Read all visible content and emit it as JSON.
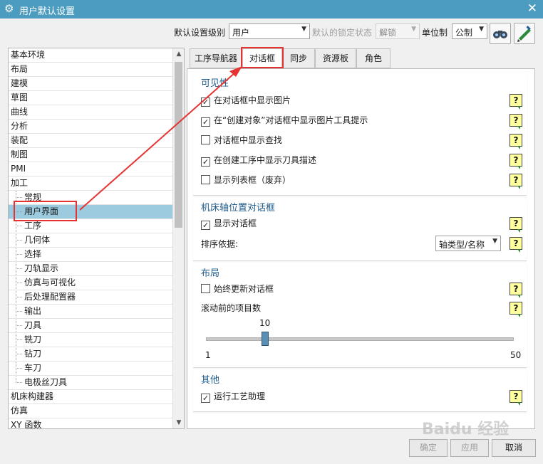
{
  "window": {
    "title": "用户默认设置",
    "close_label": "✕"
  },
  "toolbar": {
    "level_label": "默认设置级别",
    "level_value": "用户",
    "lock_label": "默认的锁定状态",
    "lock_value": "解锁",
    "unit_label": "单位制",
    "unit_value": "公制"
  },
  "tree": {
    "items": [
      "基本环境",
      "布局",
      "建模",
      "草图",
      "曲线",
      "分析",
      "装配",
      "制图",
      "PMI",
      "加工",
      "常规",
      "用户界面",
      "工序",
      "几何体",
      "选择",
      "刀轨显示",
      "仿真与可视化",
      "后处理配置器",
      "输出",
      "刀具",
      "铣刀",
      "钻刀",
      "车刀",
      "电极丝刀具",
      "机床构建器",
      "仿真",
      "XY 函数"
    ],
    "selected_index": 11
  },
  "tabs": [
    "工序导航器",
    "对话框",
    "同步",
    "资源板",
    "角色"
  ],
  "active_tab": 1,
  "sections": {
    "visibility": {
      "title": "可见性",
      "items": [
        {
          "label": "在对话框中显示图片",
          "checked": true
        },
        {
          "label": "在“创建对象”对话框中显示图片工具提示",
          "checked": true
        },
        {
          "label": "对话框中显示查找",
          "checked": false
        },
        {
          "label": "在创建工序中显示刀具描述",
          "checked": true
        },
        {
          "label": "显示列表框（废弃）",
          "checked": false
        }
      ]
    },
    "mcs": {
      "title": "机床轴位置对话框",
      "show_dialog": {
        "label": "显示对话框",
        "checked": true
      },
      "sort_label": "排序依据:",
      "sort_value": "轴类型/名称"
    },
    "layout": {
      "title": "布局",
      "always_update": {
        "label": "始终更新对话框",
        "checked": false
      },
      "scroll_label": "滚动前的项目数",
      "slider": {
        "value": "10",
        "min": "1",
        "max": "50"
      }
    },
    "other": {
      "title": "其他",
      "run_assistant": {
        "label": "运行工艺助理",
        "checked": true
      }
    }
  },
  "help_glyph": "?",
  "check_glyph": "✓",
  "buttons": {
    "ok": "确定",
    "apply": "应用",
    "cancel": "取消"
  },
  "watermark": "Baidu 经验",
  "colors": {
    "titlebar": "#4b9cbf",
    "selection": "#9ccbdf",
    "annotation": "#e53232",
    "section_title": "#1f5b8b"
  }
}
